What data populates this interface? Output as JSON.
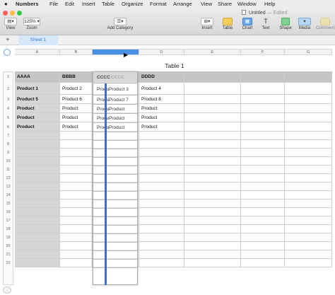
{
  "menu": {
    "apple": "",
    "app_name": "Numbers",
    "items": [
      "File",
      "Edit",
      "Insert",
      "Table",
      "Organize",
      "Format",
      "Arrange",
      "View",
      "Share",
      "Window",
      "Help"
    ]
  },
  "window": {
    "title": "Untitled",
    "status": "— Edited"
  },
  "toolbar": {
    "view_label": "View",
    "zoom_value": "125%",
    "zoom_label": "Zoom",
    "add_category_label": "Add Category",
    "insert_label": "Insert",
    "table_label": "Table",
    "chart_label": "Chart",
    "text_label": "Text",
    "text_glyph": "T",
    "shape_label": "Shape",
    "media_label": "Media",
    "comment_label": "Comment"
  },
  "sheets": {
    "add": "+",
    "tabs": [
      "Sheet 1"
    ]
  },
  "columns": [
    "A",
    "B",
    "C",
    "D",
    "E",
    "F",
    "G"
  ],
  "table": {
    "title": "Table 1",
    "headers": [
      "AAAA",
      "BBBB",
      "",
      "DDDD"
    ],
    "rows": [
      [
        "Product 1",
        "Product 2",
        "",
        "Product 4"
      ],
      [
        "Product  5",
        "Product  6",
        "",
        "Product  8"
      ],
      [
        "Product",
        "Product",
        "",
        "Product"
      ],
      [
        "Product",
        "Product",
        "",
        "Product"
      ],
      [
        "Product",
        "Product",
        "",
        "Product"
      ]
    ]
  },
  "dragged_column": {
    "header": "CCCC",
    "header_echo": "CCCC",
    "cells": [
      "Product 3",
      "Product  7",
      "Product",
      "Product",
      "Product"
    ],
    "left_fragments": [
      "Produ",
      "Produ",
      "Produ",
      "Produ",
      "Produ"
    ]
  },
  "row_numbers": [
    "1",
    "2",
    "3",
    "4",
    "5",
    "6",
    "7",
    "8",
    "9",
    "10",
    "11",
    "12",
    "13",
    "14",
    "15",
    "16",
    "17",
    "18",
    "19",
    "20",
    "21",
    "22"
  ],
  "colors": {
    "accent": "#4a90e2",
    "insertion_bar": "#3e6fc9",
    "header_fill": "#c4c4c4",
    "first_column_fill": "#d6d6d6",
    "traffic_close": "#fc605b",
    "traffic_min": "#fdbc40",
    "traffic_max": "#34c84a"
  }
}
